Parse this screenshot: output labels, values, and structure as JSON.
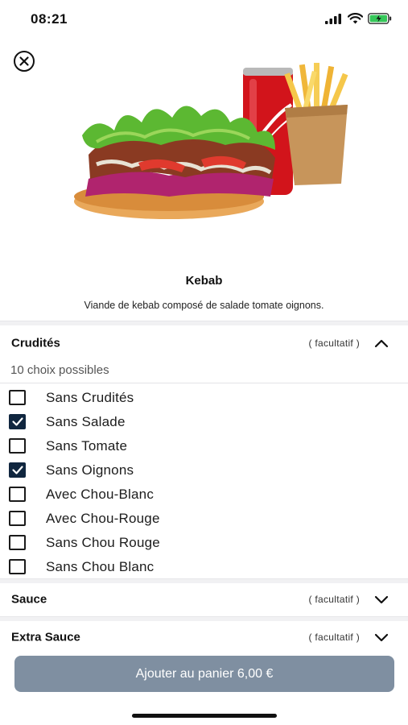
{
  "status": {
    "time": "08:21",
    "icons": [
      "signal-icon",
      "wifi-icon",
      "battery-charging-icon"
    ]
  },
  "close_icon": "close-circle-icon",
  "product": {
    "title": "Kebab",
    "description": "Viande de kebab composé de salade tomate oignons."
  },
  "groups": [
    {
      "title": "Crudités",
      "optional_label": "( facultatif )",
      "expanded": true,
      "choice_count": "10 choix possibles",
      "options": [
        {
          "label": "Sans Crudités",
          "checked": false
        },
        {
          "label": "Sans Salade",
          "checked": true
        },
        {
          "label": "Sans Tomate",
          "checked": false
        },
        {
          "label": "Sans Oignons",
          "checked": true
        },
        {
          "label": "Avec Chou-Blanc",
          "checked": false
        },
        {
          "label": "Avec Chou-Rouge",
          "checked": false
        },
        {
          "label": "Sans Chou Rouge",
          "checked": false
        },
        {
          "label": "Sans Chou Blanc",
          "checked": false
        }
      ]
    },
    {
      "title": "Sauce",
      "optional_label": "( facultatif )",
      "expanded": false
    },
    {
      "title": "Extra Sauce",
      "optional_label": "( facultatif )",
      "expanded": false
    }
  ],
  "cta": {
    "label": "Ajouter au panier 6,00 €"
  },
  "colors": {
    "checkbox_checked": "#10263f",
    "cta_background": "#7f8fa1"
  }
}
